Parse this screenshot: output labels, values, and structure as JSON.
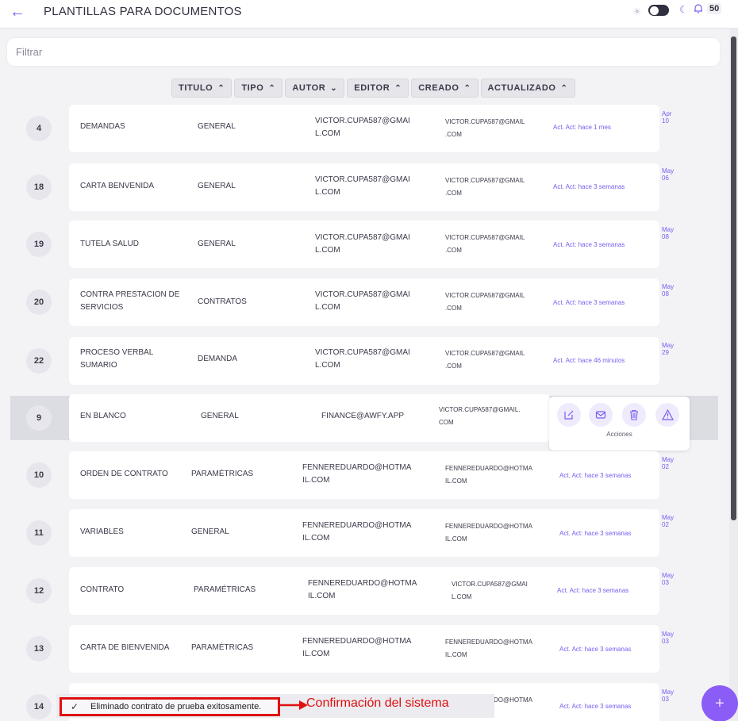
{
  "header": {
    "back_icon": "arrow-left-icon",
    "title": "PLANTILLAS PARA DOCUMENTOS",
    "notifications_count": "50"
  },
  "filter": {
    "placeholder": "Filtrar"
  },
  "sort_buttons": [
    "TITULO",
    "TIPO",
    "AUTOR",
    "EDITOR",
    "CREADO",
    "ACTUALIZADO"
  ],
  "rows": [
    {
      "num": "4",
      "title": [
        "DEMANDAS"
      ],
      "type": "GENERAL",
      "author": [
        "VICTOR.CUPA587@GMAI",
        "L.COM"
      ],
      "editor": [
        "VICTOR.CUPA587@GMAIL",
        ".COM"
      ],
      "updated": "Act. Act: hace 1 mes",
      "date": "Apr 10"
    },
    {
      "num": "18",
      "title": [
        "CARTA BENVENIDA"
      ],
      "type": "GENERAL",
      "author": [
        "VICTOR.CUPA587@GMAI",
        "L.COM"
      ],
      "editor": [
        "VICTOR.CUPA587@GMAIL",
        ".COM"
      ],
      "updated": "Act. Act: hace 3 semanas",
      "date": "May 06"
    },
    {
      "num": "19",
      "title": [
        "TUTELA SALUD"
      ],
      "type": "GENERAL",
      "author": [
        "VICTOR.CUPA587@GMAI",
        "L.COM"
      ],
      "editor": [
        "VICTOR.CUPA587@GMAIL",
        ".COM"
      ],
      "updated": "Act. Act: hace 3 semanas",
      "date": "May 08"
    },
    {
      "num": "20",
      "title": [
        "CONTRA PRESTACION DE",
        "SERVICIOS"
      ],
      "type": "CONTRATOS",
      "author": [
        "VICTOR.CUPA587@GMAI",
        "L.COM"
      ],
      "editor": [
        "VICTOR.CUPA587@GMAIL",
        ".COM"
      ],
      "updated": "Act. Act: hace 3 semanas",
      "date": "May 08"
    },
    {
      "num": "22",
      "title": [
        "PROCESO VERBAL",
        "SUMARIO"
      ],
      "type": "DEMANDA",
      "author": [
        "VICTOR.CUPA587@GMAI",
        "L.COM"
      ],
      "editor": [
        "VICTOR.CUPA587@GMAIL",
        ".COM"
      ],
      "updated": "Act. Act: hace 46 minutos",
      "date": "May 29"
    },
    {
      "num": "9",
      "title": [
        "EN BLANCO"
      ],
      "type": "GENERAL",
      "author": [
        "FINANCE@AWFY.APP"
      ],
      "editor": [
        "VICTOR.CUPA587@GMAIL.",
        "COM"
      ],
      "updated": "",
      "date": ""
    },
    {
      "num": "10",
      "title": [
        "ORDEN DE CONTRATO"
      ],
      "type": "PARAMÉTRICAS",
      "author": [
        "FENNEREDUARDO@HOTMA",
        "IL.COM"
      ],
      "editor": [
        "FENNEREDUARDO@HOTMA",
        "IL.COM"
      ],
      "updated": "Act. Act: hace 3 semanas",
      "date": "May 02"
    },
    {
      "num": "11",
      "title": [
        "VARIABLES"
      ],
      "type": "GENERAL",
      "author": [
        "FENNEREDUARDO@HOTMA",
        "IL.COM"
      ],
      "editor": [
        "FENNEREDUARDO@HOTMA",
        "IL.COM"
      ],
      "updated": "Act. Act: hace 3 semanas",
      "date": "May 02"
    },
    {
      "num": "12",
      "title": [
        "CONTRATO"
      ],
      "type": "PARAMÉTRICAS",
      "author": [
        "FENNEREDUARDO@HOTMA",
        "IL.COM"
      ],
      "editor": [
        "VICTOR.CUPA587@GMAI",
        "L.COM"
      ],
      "updated": "Act. Act: hace 3 semanas",
      "date": "May 03"
    },
    {
      "num": "13",
      "title": [
        "CARTA DE BIENVENIDA"
      ],
      "type": "PARAMÉTRICAS",
      "author": [
        "FENNEREDUARDO@HOTMA",
        "IL.COM"
      ],
      "editor": [
        "FENNEREDUARDO@HOTMA",
        "IL.COM"
      ],
      "updated": "Act. Act: hace 3 semanas",
      "date": "May 03"
    },
    {
      "num": "14",
      "title": [
        ""
      ],
      "type": "",
      "author": [
        ""
      ],
      "editor": [
        "DO@HOTMA"
      ],
      "updated": "Act. Act: hace 3 semanas",
      "date": "May 03"
    }
  ],
  "actions": {
    "label": "Acciones",
    "icons": [
      "edit-icon",
      "mail-icon",
      "trash-icon",
      "warning-icon"
    ]
  },
  "toast": {
    "message": "Eliminado contrato de prueba exitosamente."
  },
  "annotation": {
    "text": "Confirmación del sistema"
  },
  "colors": {
    "accent": "#7a5cf0",
    "fab": "#8b5cf6",
    "annotation": "#e01010"
  }
}
